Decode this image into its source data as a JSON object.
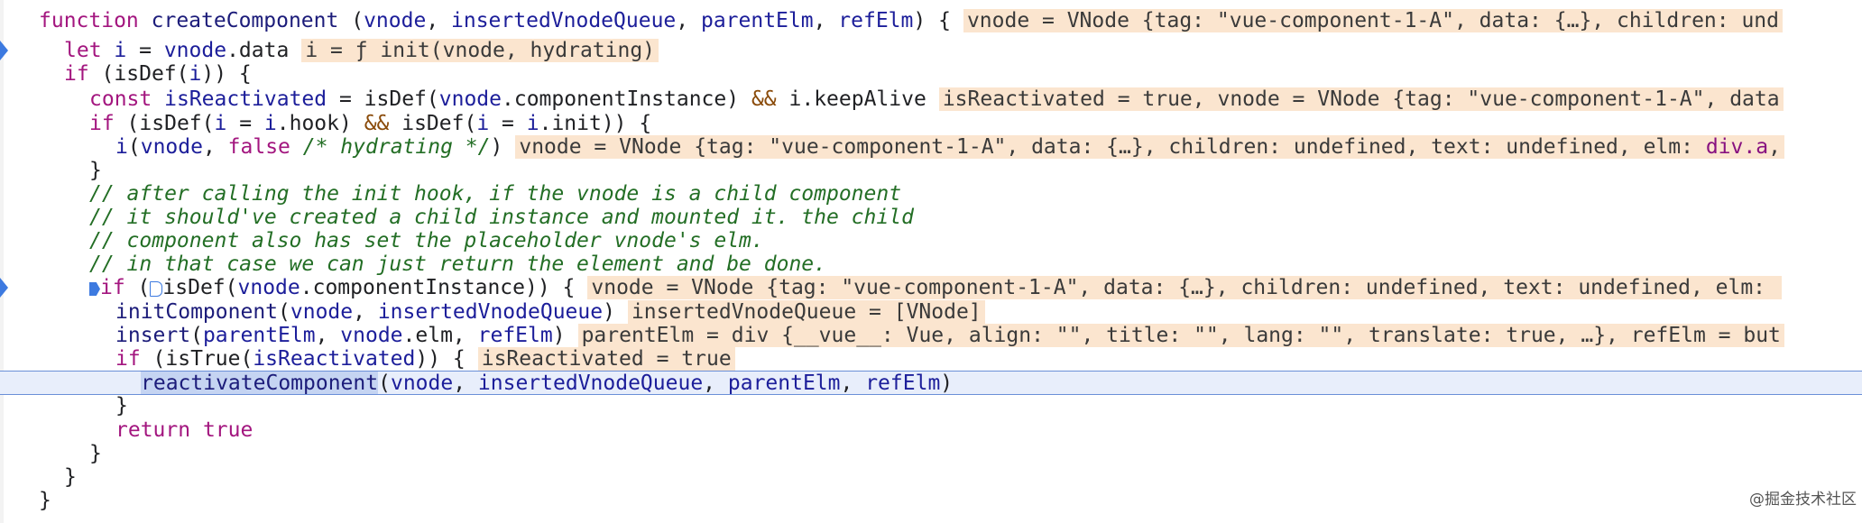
{
  "source": {
    "l1": {
      "kw": "function",
      "name": "createComponent",
      "open": " (",
      "p1": "vnode",
      "c1": ", ",
      "p2": "insertedVnodeQueue",
      "c2": ", ",
      "p3": "parentElm",
      "c3": ", ",
      "p4": "refElm",
      "close": ") {",
      "inline": "vnode = VNode {tag: \"vue-component-1-A\", data: {…}, children: und"
    },
    "l2": {
      "kw": "let",
      "sp": " ",
      "var": "i",
      "eq": " = ",
      "obj": "vnode",
      "rest": ".data",
      "inline": "i = ƒ init(vnode, hydrating)"
    },
    "l3": {
      "kw": "if",
      "rest": " (isDef(",
      "arg": "i",
      "close": ")) {"
    },
    "l4": {
      "kw": "const",
      "sp": " ",
      "var": "isReactivated",
      "eq": " = isDef(",
      "obj": "vnode",
      "mid": ".componentInstance) ",
      "and": "&&",
      "tail": " i.keepAlive",
      "inline": "isReactivated = true, vnode = VNode {tag: \"vue-component-1-A\", data"
    },
    "l5": {
      "kw": "if",
      "a": " (isDef(",
      "v1": "i",
      "b": " = ",
      "v2": "i",
      "c": ".hook) ",
      "and": "&&",
      "d": " isDef(",
      "v3": "i",
      "e": " = ",
      "v4": "i",
      "f": ".init)) {"
    },
    "l6": {
      "fn": "i",
      "open": "(",
      "arg": "vnode",
      "comma": ", ",
      "kw": "false",
      "comment": " /* hydrating */",
      "close": ")",
      "inline": "vnode = VNode {tag: \"vue-component-1-A\", data: {…}, children: undefined, text: undefined, elm: ",
      "inline_el": "div.a",
      "inline_tail": ","
    },
    "l7": {
      "text": "}"
    },
    "l8": {
      "text": "// after calling the init hook, if the vnode is a child component"
    },
    "l9": {
      "text": "// it should've created a child instance and mounted it. the child"
    },
    "l10": {
      "text": "// component also has set the placeholder vnode's elm."
    },
    "l11": {
      "text": "// in that case we can just return the element and be done."
    },
    "l12": {
      "kw": "if",
      "open": " (",
      "rest": "isDef(",
      "obj": "vnode",
      "tail": ".componentInstance)) {",
      "inline": "vnode = VNode {tag: \"vue-component-1-A\", data: {…}, children: undefined, text: undefined, elm: "
    },
    "l13": {
      "fn": "initComponent",
      "open": "(",
      "a1": "vnode",
      "c": ", ",
      "a2": "insertedVnodeQueue",
      "close": ")",
      "inline": "insertedVnodeQueue = [VNode]"
    },
    "l14": {
      "fn": "insert",
      "open": "(",
      "a1": "parentElm",
      "c1": ", ",
      "a2": "vnode",
      "mid": ".elm, ",
      "a3": "refElm",
      "close": ")",
      "inline": "parentElm = div {__vue__: Vue, align: \"\", title: \"\", lang: \"\", translate: true, …}, refElm = but"
    },
    "l15": {
      "kw": "if",
      "a": " (isTrue(",
      "arg": "isReactivated",
      "close": ")) {",
      "inline": "isReactivated = true"
    },
    "l16": {
      "fn": "reactivateComponent",
      "open": "(",
      "a1": "vnode",
      "c1": ", ",
      "a2": "insertedVnodeQueue",
      "c2": ", ",
      "a3": "parentElm",
      "c3": ", ",
      "a4": "refElm",
      "close": ")"
    },
    "l17": {
      "text": "}"
    },
    "l18": {
      "kw": "return",
      "sp": " ",
      "val": "true"
    },
    "l19": {
      "text": "}"
    },
    "l20": {
      "text": "}"
    },
    "l21": {
      "text": "}"
    }
  },
  "watermark": "@掘金技术社区",
  "colors": {
    "keyword": "#a3167f",
    "function_name": "#1c1c7a",
    "parameter": "#1c1e9a",
    "comment": "#236e25",
    "inline_value_bg": "#fbe5cf",
    "current_line_bg": "#e8eefb",
    "breakpoint": "#3d7ae0"
  },
  "icons": [
    "breakpoint-icon",
    "execution-step-icon",
    "inline-step-icon"
  ]
}
